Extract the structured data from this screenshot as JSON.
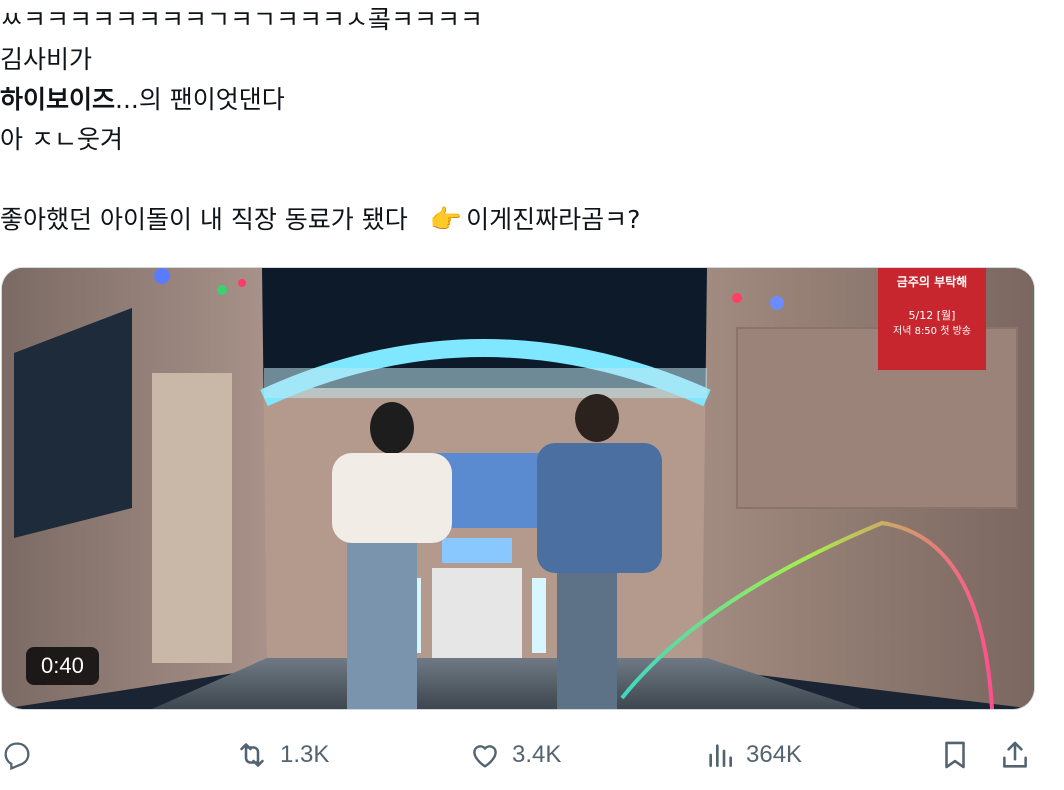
{
  "tweet": {
    "lines": [
      "ㅆㅋㅋㅋㅋㅋㅋㅋㅋㄱㅋㄱㅋㅋㅋㅅ콬ㅋㅋㅋㅋ",
      "김사비가",
      "",
      "아 ㅈㄴ웃겨",
      "",
      "좋아했던 아이돌이 내 직장 동료가 됐다"
    ],
    "line3_bold": "하이보이즈",
    "line3_rest": "...의 팬이엇댄다",
    "last_suffix": "이게진짜라곰ㅋ?",
    "emoji": "👉"
  },
  "media": {
    "duration": "0:40",
    "promo_title": "금주의 부탁해",
    "promo_date": "5/12 [월]",
    "promo_time": "저녁 8:50 첫 방송"
  },
  "actions": {
    "reply_count": "",
    "retweet_count": "1.3K",
    "like_count": "3.4K",
    "views_count": "364K"
  },
  "colors": {
    "icon": "#536471",
    "border": "#cfd9de",
    "text": "#0f1419"
  }
}
